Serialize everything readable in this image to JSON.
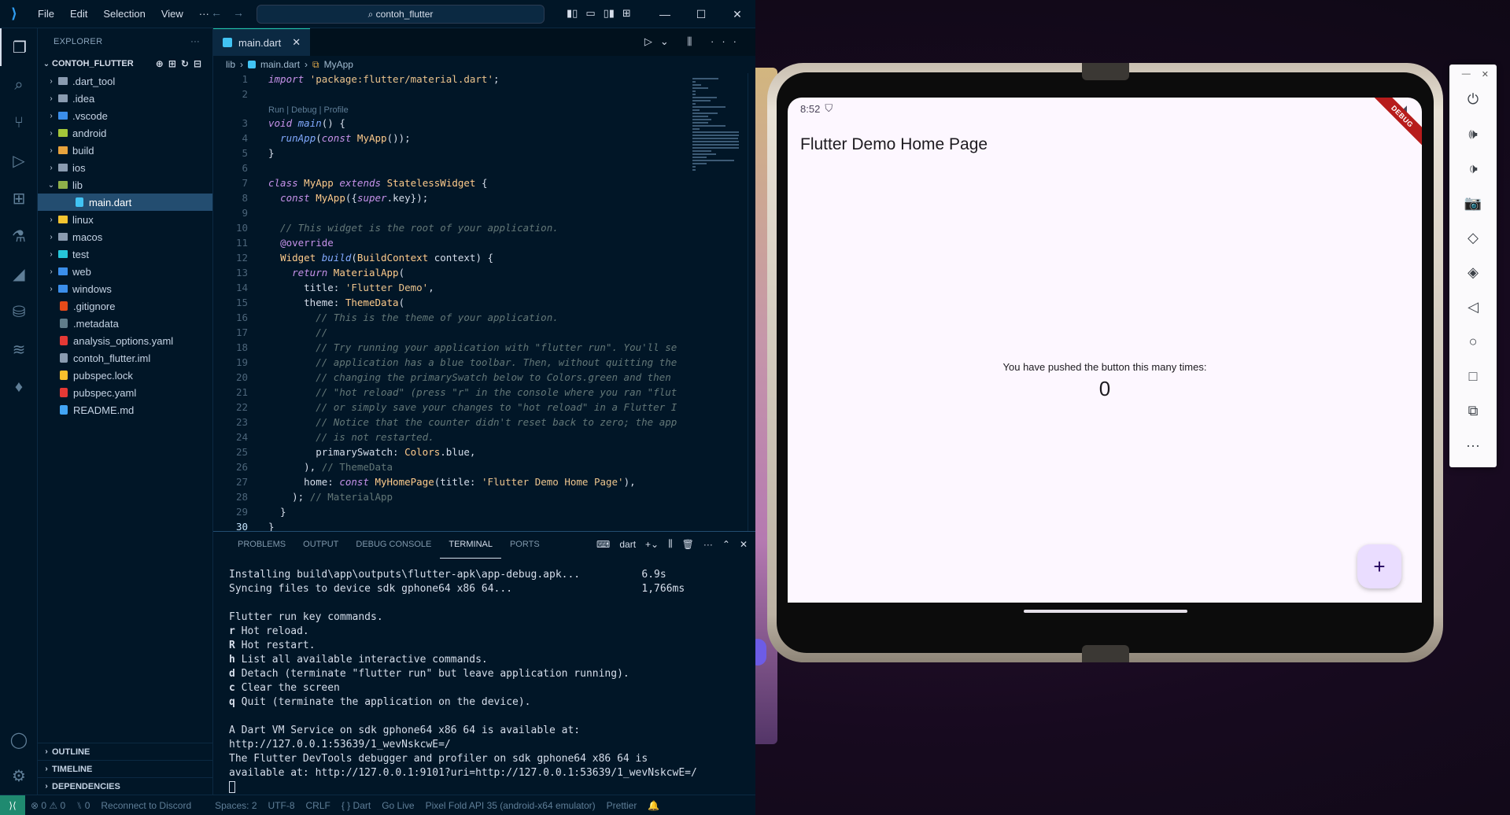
{
  "titlebar": {
    "menu": [
      "File",
      "Edit",
      "Selection",
      "View",
      "···"
    ],
    "command_center": "contoh_flutter"
  },
  "sidebar": {
    "title": "EXPLORER",
    "project": "CONTOH_FLUTTER",
    "items": [
      {
        "label": ".dart_tool",
        "type": "folder",
        "color": "#8a9bb0",
        "level": 1
      },
      {
        "label": ".idea",
        "type": "folder",
        "color": "#8a9bb0",
        "level": 1
      },
      {
        "label": ".vscode",
        "type": "folder",
        "color": "#3b8eea",
        "level": 1
      },
      {
        "label": "android",
        "type": "folder",
        "color": "#a4c639",
        "level": 1
      },
      {
        "label": "build",
        "type": "folder",
        "color": "#e8a33d",
        "level": 1
      },
      {
        "label": "ios",
        "type": "folder",
        "color": "#8a9bb0",
        "level": 1
      },
      {
        "label": "lib",
        "type": "folder-open",
        "color": "#8fb04a",
        "level": 1
      },
      {
        "label": "main.dart",
        "type": "file",
        "color": "#41c3f3",
        "level": 2
      },
      {
        "label": "linux",
        "type": "folder",
        "color": "#f4c430",
        "level": 1
      },
      {
        "label": "macos",
        "type": "folder",
        "color": "#8a9bb0",
        "level": 1
      },
      {
        "label": "test",
        "type": "folder",
        "color": "#26c6da",
        "level": 1
      },
      {
        "label": "web",
        "type": "folder",
        "color": "#3b8eea",
        "level": 1
      },
      {
        "label": "windows",
        "type": "folder",
        "color": "#3b8eea",
        "level": 1
      },
      {
        "label": ".gitignore",
        "type": "file",
        "color": "#e64a19",
        "level": 1
      },
      {
        "label": ".metadata",
        "type": "file",
        "color": "#607d8b",
        "level": 1
      },
      {
        "label": "analysis_options.yaml",
        "type": "file",
        "color": "#e53935",
        "level": 1
      },
      {
        "label": "contoh_flutter.iml",
        "type": "file",
        "color": "#8a9bb0",
        "level": 1
      },
      {
        "label": "pubspec.lock",
        "type": "file",
        "color": "#fbc02d",
        "level": 1
      },
      {
        "label": "pubspec.yaml",
        "type": "file",
        "color": "#e53935",
        "level": 1
      },
      {
        "label": "README.md",
        "type": "file",
        "color": "#42a5f5",
        "level": 1
      }
    ],
    "sections": [
      "OUTLINE",
      "TIMELINE",
      "DEPENDENCIES"
    ]
  },
  "editor": {
    "tab": "main.dart",
    "breadcrumb": [
      "lib",
      "main.dart",
      "MyApp"
    ],
    "codelens": "Run | Debug | Profile",
    "lines": [
      {
        "n": "1",
        "t": "import 'package:flutter/material.dart';"
      },
      {
        "n": "2",
        "t": ""
      },
      {
        "n": "3",
        "t": "void main() {",
        "lens": true
      },
      {
        "n": "4",
        "t": "  runApp(const MyApp());"
      },
      {
        "n": "5",
        "t": "}"
      },
      {
        "n": "6",
        "t": ""
      },
      {
        "n": "7",
        "t": "class MyApp extends StatelessWidget {"
      },
      {
        "n": "8",
        "t": "  const MyApp({super.key});"
      },
      {
        "n": "9",
        "t": ""
      },
      {
        "n": "10",
        "t": "  // This widget is the root of your application."
      },
      {
        "n": "11",
        "t": "  @override"
      },
      {
        "n": "12",
        "t": "  Widget build(BuildContext context) {"
      },
      {
        "n": "13",
        "t": "    return MaterialApp("
      },
      {
        "n": "14",
        "t": "      title: 'Flutter Demo',"
      },
      {
        "n": "15",
        "t": "      theme: ThemeData("
      },
      {
        "n": "16",
        "t": "        // This is the theme of your application."
      },
      {
        "n": "17",
        "t": "        //"
      },
      {
        "n": "18",
        "t": "        // Try running your application with \"flutter run\". You'll se"
      },
      {
        "n": "19",
        "t": "        // application has a blue toolbar. Then, without quitting the"
      },
      {
        "n": "20",
        "t": "        // changing the primarySwatch below to Colors.green and then"
      },
      {
        "n": "21",
        "t": "        // \"hot reload\" (press \"r\" in the console where you ran \"flut"
      },
      {
        "n": "22",
        "t": "        // or simply save your changes to \"hot reload\" in a Flutter I"
      },
      {
        "n": "23",
        "t": "        // Notice that the counter didn't reset back to zero; the app"
      },
      {
        "n": "24",
        "t": "        // is not restarted."
      },
      {
        "n": "25",
        "t": "        primarySwatch: Colors.blue,"
      },
      {
        "n": "26",
        "t": "      ), // ThemeData"
      },
      {
        "n": "27",
        "t": "      home: const MyHomePage(title: 'Flutter Demo Home Page'),"
      },
      {
        "n": "28",
        "t": "    ); // MaterialApp"
      },
      {
        "n": "29",
        "t": "  }"
      },
      {
        "n": "30",
        "t": "}"
      }
    ]
  },
  "panel": {
    "tabs": [
      "PROBLEMS",
      "OUTPUT",
      "DEBUG CONSOLE",
      "TERMINAL",
      "PORTS"
    ],
    "active_tab": "TERMINAL",
    "terminal_name": "dart",
    "terminal_lines": [
      "Installing build\\app\\outputs\\flutter-apk\\app-debug.apk...          6.9s",
      "Syncing files to device sdk gphone64 x86 64...                     1,766ms",
      "",
      "Flutter run key commands.",
      "r Hot reload.",
      "R Hot restart.",
      "h List all available interactive commands.",
      "d Detach (terminate \"flutter run\" but leave application running).",
      "c Clear the screen",
      "q Quit (terminate the application on the device).",
      "",
      "A Dart VM Service on sdk gphone64 x86 64 is available at:",
      "http://127.0.0.1:53639/1_wevNskcwE=/",
      "The Flutter DevTools debugger and profiler on sdk gphone64 x86 64 is",
      "available at: http://127.0.0.1:9101?uri=http://127.0.0.1:53639/1_wevNskcwE=/"
    ]
  },
  "statusbar": {
    "errors": "⊗ 0 ⚠ 0",
    "ports": "⑊ 0",
    "discord": "Reconnect to Discord",
    "spaces": "Spaces: 2",
    "encoding": "UTF-8",
    "eol": "CRLF",
    "language": "{ } Dart",
    "golive": "Go Live",
    "device": "Pixel Fold API 35 (android-x64 emulator)",
    "prettier": "Prettier"
  },
  "emulator": {
    "time": "8:52",
    "debug_banner": "DEBUG",
    "app_title": "Flutter Demo Home Page",
    "message": "You have pushed the button this many times:",
    "counter": "0",
    "fab": "+"
  }
}
